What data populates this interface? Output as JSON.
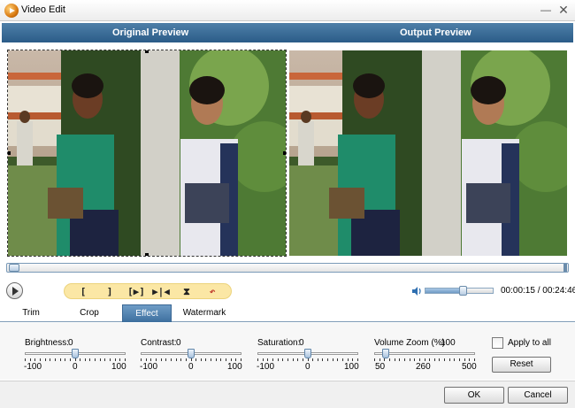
{
  "window": {
    "title": "Video Edit",
    "minimize_label": "—",
    "close_label": "✕"
  },
  "preview": {
    "original_label": "Original Preview",
    "output_label": "Output Preview"
  },
  "timeline": {
    "position": 0.0
  },
  "toolbar": {
    "buttons": [
      {
        "label": "[",
        "icon": "set-start-icon"
      },
      {
        "label": "]",
        "icon": "set-end-icon"
      },
      {
        "label": "[▶]",
        "icon": "play-selection-icon"
      },
      {
        "label": "▶|◀",
        "icon": "split-icon"
      },
      {
        "label": "⧗",
        "icon": "merge-icon"
      },
      {
        "label": "↶",
        "icon": "undo-icon"
      }
    ]
  },
  "playback": {
    "current_time": "00:00:15",
    "total_time": "00:24:46",
    "time_display": "00:00:15 / 00:24:46",
    "volume_level": 0.55
  },
  "tabs": [
    {
      "label": "Trim",
      "active": false
    },
    {
      "label": "Crop",
      "active": false
    },
    {
      "label": "Effect",
      "active": true
    },
    {
      "label": "Watermark",
      "active": false
    }
  ],
  "effect": {
    "brightness": {
      "label": "Brightness:",
      "value": "0",
      "min": "-100",
      "mid": "0",
      "max": "100",
      "level": 0.5
    },
    "contrast": {
      "label": "Contrast:",
      "value": "0",
      "min": "-100",
      "mid": "0",
      "max": "100",
      "level": 0.5
    },
    "saturation": {
      "label": "Saturation:",
      "value": "0",
      "min": "-100",
      "mid": "0",
      "max": "100",
      "level": 0.5
    },
    "volume_zoom": {
      "label": "Volume Zoom (%)",
      "value": "100",
      "min": "50",
      "mid": "260",
      "max": "500",
      "level": 0.11
    },
    "apply_to_all_label": "Apply to all",
    "apply_to_all_checked": false,
    "reset_label": "Reset"
  },
  "footer": {
    "ok_label": "OK",
    "cancel_label": "Cancel"
  },
  "colors": {
    "header_blue": "#2b5c88",
    "tab_active": "#3d6f9e",
    "toolbar_yellow": "#fbe7a5"
  }
}
